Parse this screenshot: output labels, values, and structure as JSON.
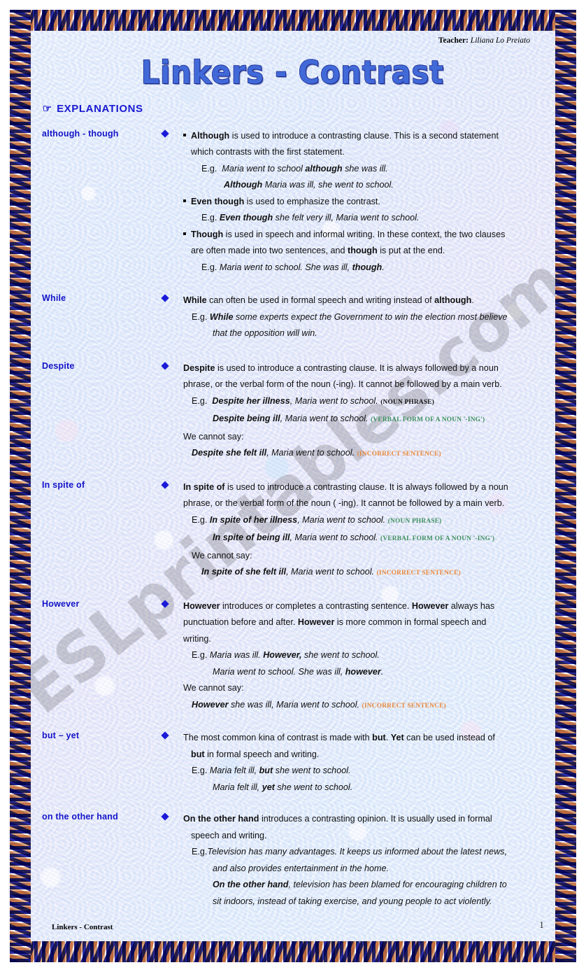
{
  "document": {
    "title": "Linkers - Contrast",
    "teacher_label": "Teacher:",
    "teacher_name": "Liliana Lo Preiato",
    "section_heading": "EXPLANATIONS",
    "heading_icon": "pointing-hand-icon",
    "footer_title": "Linkers - Contrast",
    "page_number": "1",
    "watermark": "ESLprintables.com"
  },
  "colors": {
    "title_fill": "#4169d8",
    "title_outline": "#1b2a8c",
    "label_blue": "#1414c8",
    "heading_blue": "#1a1ad0",
    "bullet_diamond": "#1a1ad8",
    "tag_green": "#3f8f5f",
    "tag_orange": "#e8883a",
    "paper": "#dbe9fb",
    "border_navy": "#1b1e8c",
    "border_tan": "#d9a279"
  },
  "sections": {
    "although": {
      "label": "although - though",
      "b1_l1_a": "Although",
      "b1_l1_b": " is used to introduce a contrasting clause. This is a second statement",
      "b1_l2": "which contrasts with the first statement.",
      "eg1_prefix": "E.g.",
      "eg1_a": "Maria went to school ",
      "eg1_b": "although",
      "eg1_c": " she was ill.",
      "eg2_a": "Although",
      "eg2_b": " Maria was ill, she went to school.",
      "b2_a": "Even though",
      "b2_b": " is used to emphasize the contrast.",
      "eg3_prefix": "E.g.",
      "eg3_a": "Even though",
      "eg3_b": " she felt very ill, Maria went to school.",
      "b3_a": "Though",
      "b3_b": " is used in speech and informal writing. In these context, the two clauses",
      "b3_l2_a": "are often made into two sentences, and ",
      "b3_l2_b": "though",
      "b3_l2_c": " is put at the end.",
      "eg4_prefix": "E.g.",
      "eg4_a": "Maria went to school. She was ill, ",
      "eg4_b": "though",
      "eg4_c": "."
    },
    "while": {
      "label": "While",
      "l1_a": "While",
      "l1_b": " can often be used in formal speech and writing instead of ",
      "l1_c": "although",
      "l1_d": ".",
      "eg_prefix": "E.g.",
      "eg_a": "While",
      "eg_b": " some experts expect the Government to win the election most believe",
      "eg_l2": "that the opposition will win."
    },
    "despite": {
      "label": "Despite",
      "l1_a": "Despite",
      "l1_b": " is used to introduce a contrasting clause. It is always followed by a noun",
      "l2": "phrase, or the verbal form of the noun (-ing). It cannot be followed by a main verb.",
      "eg_prefix": "E.g.",
      "eg1_a": "Despite her illness",
      "eg1_b": ", Maria went to school.",
      "eg1_tag": "(NOUN PHRASE)",
      "eg2_a": "Despite being ill",
      "eg2_b": ", Maria went to school.",
      "eg2_tag": "(VERBAL FORM OF A NOUN '-ING')",
      "cannot": "We cannot say:",
      "eg3_a": "Despite she felt ill",
      "eg3_b": ", Maria went to school.",
      "eg3_tag": "(INCORRECT SENTENCE)"
    },
    "inspiteof": {
      "label": "In spite of",
      "l1_a": "In spite of",
      "l1_b": " is used to introduce a contrasting clause. It is always followed by a noun",
      "l2": "phrase, or the verbal form of the noun ( -ing). It cannot be followed by a main verb.",
      "eg_prefix": "E.g.",
      "eg1_a": "In spite of her illness",
      "eg1_b": ", Maria went to school.",
      "eg1_tag": "(NOUN PHRASE)",
      "eg2_a": "In spite of being ill",
      "eg2_b": ", Maria went to school.",
      "eg2_tag": "(VERBAL FORM OF A NOUN '-ING')",
      "cannot": "We cannot say:",
      "eg3_a": "In spite of she felt ill",
      "eg3_b": ", Maria went to school.",
      "eg3_tag": "(INCORRECT SENTENCE)"
    },
    "however": {
      "label": "However",
      "l1_a": "However",
      "l1_b": " introduces or completes a contrasting sentence. ",
      "l1_c": "However",
      "l1_d": " always has",
      "l2_a": "punctuation before and after. ",
      "l2_b": "However",
      "l2_c": " is more common in formal speech and",
      "l3": "writing.",
      "eg_prefix": "E.g.",
      "eg1_a": "Maria was ill. ",
      "eg1_b": "However,",
      "eg1_c": " she went to school.",
      "eg2_a": "Maria went to school. She was ill, ",
      "eg2_b": "however",
      "eg2_c": ".",
      "cannot": "We cannot say:",
      "eg3_a": "However",
      "eg3_b": " she was ill, Maria went to school.",
      "eg3_tag": "(INCORRECT SENTENCE)"
    },
    "butyet": {
      "label": "but – yet",
      "l1_a": "The most common kina of contrast is made with ",
      "l1_b": "but",
      "l1_c": ". ",
      "l1_d": "Yet",
      "l1_e": " can be used instead of",
      "l2_a": "but",
      "l2_b": " in formal speech and writing.",
      "eg_prefix": "E.g.",
      "eg1_a": "Maria felt ill, ",
      "eg1_b": "but",
      "eg1_c": " she went to school.",
      "eg2_a": "Maria felt ill, ",
      "eg2_b": "yet",
      "eg2_c": " she went to school."
    },
    "otherhand": {
      "label": "on the other hand",
      "l1_a": "On the other hand",
      "l1_b": " introduces a contrasting opinion. It is usually used in formal",
      "l2": "speech and writing.",
      "eg_prefix": "E.g.",
      "eg1_a": "Television has many advantages. It keeps us informed about the latest news,",
      "eg1_l2": "and also provides entertainment in the home.",
      "eg2_a": "On the other hand",
      "eg2_b": ", television has been blamed for encouraging children to",
      "eg2_l2": "sit indoors, instead of taking exercise, and young people to act violently."
    }
  }
}
